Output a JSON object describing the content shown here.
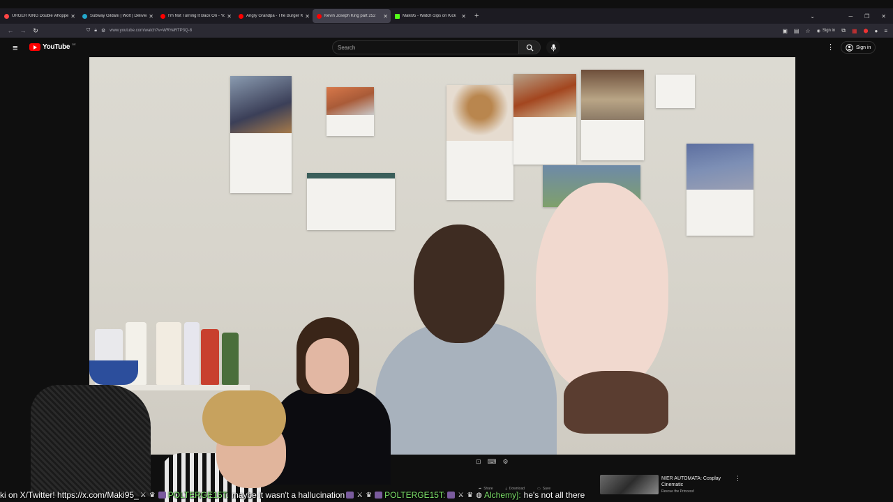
{
  "browser": {
    "tabs": [
      {
        "title": "URGER KING Double whoppe",
        "favicon_color": "#ff4444"
      },
      {
        "title": "Subway Gildani | Wolt | Delivery",
        "favicon_color": "#23a6c9"
      },
      {
        "title": "I'm Not Turning It Back On - Yo",
        "favicon_color": "#ff0000"
      },
      {
        "title": "Angry Grandpa - The Burger Ki",
        "favicon_color": "#ff0000"
      },
      {
        "title": "Kevin Joseph King part 252",
        "favicon_color": "#ff0000",
        "active": true
      },
      {
        "title": "Maki95 - Watch clips on Kick",
        "favicon_color": "#53fc18"
      }
    ],
    "url": "www.youtube.com/watch?v=WRYeRTP3Q-8",
    "sign_in_small": "Sign in"
  },
  "youtube": {
    "logo_text": "YouTube",
    "logo_country": "DE",
    "search_placeholder": "Search",
    "sign_in": "Sign in"
  },
  "player": {
    "actions": [
      "Share",
      "Download",
      "Save"
    ]
  },
  "recommendation": {
    "title": "NIER AUTOMATA: Cosplay Cinematic",
    "channel": "Rescue the Princess!"
  },
  "chat_ticker": {
    "lead": "ki on X/Twitter! https://x.com/Maki95_",
    "user1": "POLTERGE15T:",
    "msg1": "maybe it wasn't a hallucination",
    "user2": "POLTERGE15T:",
    "user3": "Alchemy]:",
    "msg3": "he's not all there"
  },
  "colors": {
    "yt_red": "#ff0000",
    "background": "#0f0f0f",
    "chat_user": "#7ee36b"
  }
}
